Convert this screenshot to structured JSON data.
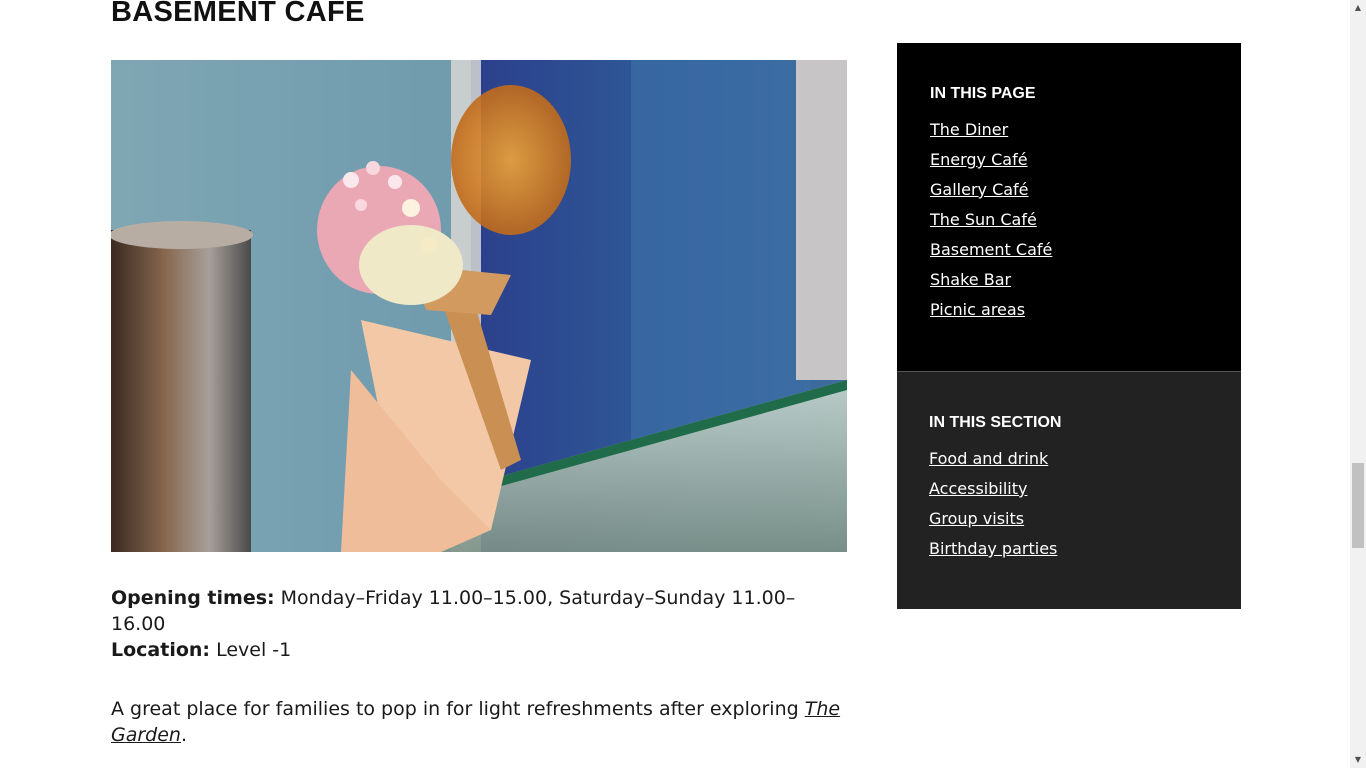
{
  "heading": "BASEMENT CAFE",
  "hero_image": {
    "alt": "ice-cream-cone-photo"
  },
  "info": {
    "opening_label": "Opening times:",
    "opening_value": "Monday–Friday 11.00–15.00, Saturday–Sunday 11.00–16.00",
    "location_label": "Location:",
    "location_value": "Level -1"
  },
  "description": {
    "text": "A great place for families to pop in for light refreshments after exploring ",
    "link": "The Garden",
    "suffix": "."
  },
  "in_this_page": {
    "title": "IN THIS PAGE",
    "links": [
      "The Diner",
      "Energy Café",
      "Gallery Café",
      "The Sun Café",
      "Basement Café",
      "Shake Bar",
      "Picnic areas"
    ]
  },
  "in_this_section": {
    "title": "IN THIS SECTION",
    "links": [
      "Food and drink",
      "Accessibility",
      "Group visits",
      "Birthday parties"
    ]
  },
  "scrollbar": {
    "up_icon": "▲",
    "down_icon": "▼"
  },
  "colors": {
    "panel_page_bg": "#000000",
    "panel_section_bg": "#222222",
    "text": "#111111"
  }
}
